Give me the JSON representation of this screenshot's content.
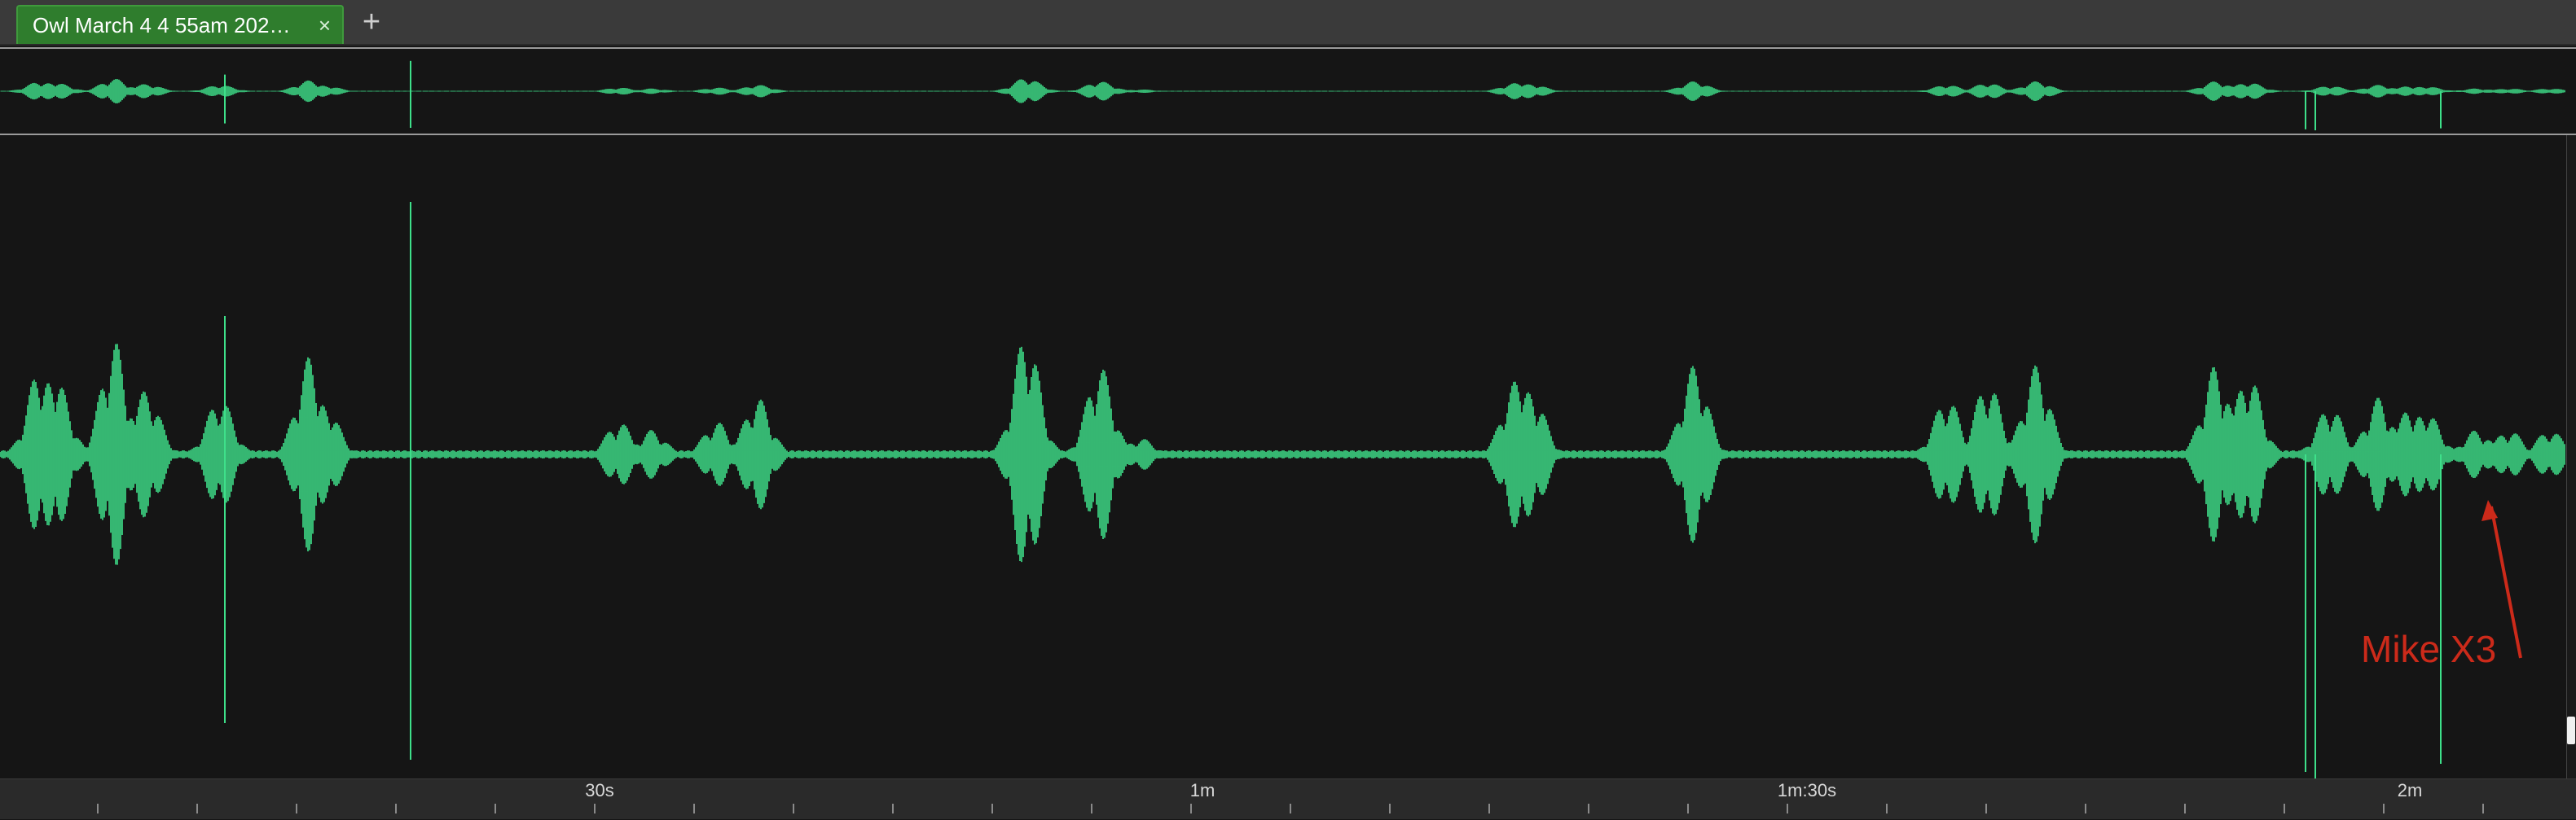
{
  "tab": {
    "title": "Owl March 4 4 55am 202…",
    "close_glyph": "×",
    "new_tab_glyph": "+"
  },
  "waveform": {
    "color": "#3ee08a",
    "background": "#151515"
  },
  "timeline": {
    "ticks": [
      {
        "label": "30s"
      },
      {
        "label": "1m"
      },
      {
        "label": "1m:30s"
      },
      {
        "label": "2m"
      }
    ]
  },
  "annotation": {
    "text": "Mike X3",
    "color": "#cc2a1a"
  }
}
